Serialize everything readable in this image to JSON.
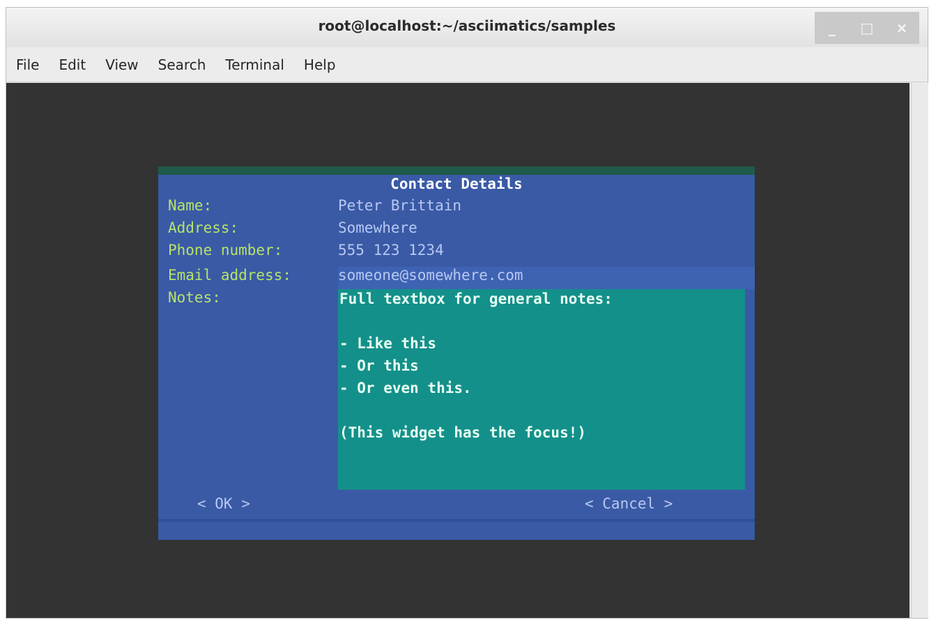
{
  "window": {
    "title": "root@localhost:~/asciimatics/samples",
    "controls": [
      "_",
      "□",
      "×"
    ]
  },
  "menu": {
    "items": [
      "File",
      "Edit",
      "View",
      "Search",
      "Terminal",
      "Help"
    ]
  },
  "dialog": {
    "title": "Contact Details",
    "fields": [
      {
        "label": "Name:",
        "value": "Peter Brittain"
      },
      {
        "label": "Address:",
        "value": "Somewhere"
      },
      {
        "label": "Phone number:",
        "value": "555 123 1234"
      },
      {
        "label": "Email address:",
        "value": "someone@somewhere.com"
      },
      {
        "label": "Notes:",
        "value": ""
      }
    ],
    "notes_lines": [
      "Full textbox for general notes:",
      "",
      "- Like this",
      "- Or this",
      "- Or even this.",
      "",
      "(This widget has the focus!)"
    ],
    "buttons": {
      "ok": "< OK >",
      "cancel": "< Cancel >"
    }
  },
  "colors": {
    "terminal_bg": "#333333",
    "dialog_bg": "#3a5aa6",
    "label": "#b7e36a",
    "focus_bg": "#14908a"
  }
}
